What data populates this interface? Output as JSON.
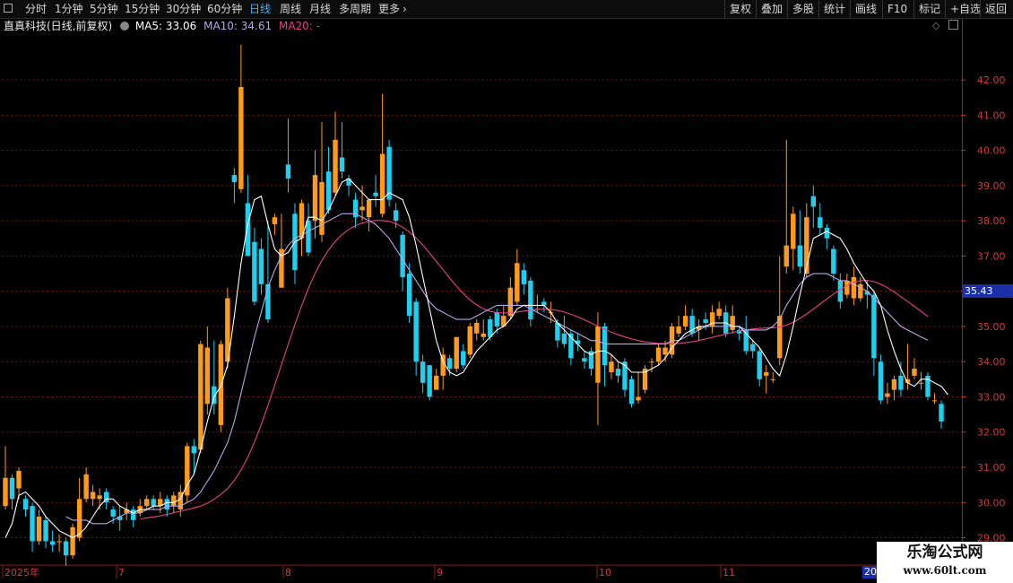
{
  "toolbar": {
    "periods": [
      {
        "label": "分时",
        "active": false
      },
      {
        "label": "1分钟",
        "active": false
      },
      {
        "label": "5分钟",
        "active": false
      },
      {
        "label": "15分钟",
        "active": false
      },
      {
        "label": "30分钟",
        "active": false
      },
      {
        "label": "60分钟",
        "active": false
      },
      {
        "label": "日线",
        "active": true
      },
      {
        "label": "周线",
        "active": false
      },
      {
        "label": "月线",
        "active": false
      },
      {
        "label": "多周期",
        "active": false
      },
      {
        "label": "更多",
        "active": false
      }
    ],
    "right_buttons": [
      "复权",
      "叠加",
      "多股",
      "统计",
      "画线",
      "F10",
      "标记",
      "+自选",
      "返回"
    ]
  },
  "info": {
    "stock": "直真科技(日线,前复权)",
    "ma5": "MA5: 33.06",
    "ma10": "MA10: 34.61",
    "ma20": "MA20: -"
  },
  "price_tag": "35.43",
  "date_end": "20",
  "watermark": {
    "title": "乐淘公式网",
    "url": "www.60lt.com"
  },
  "colors": {
    "up": "#ff9b1a",
    "down": "#1ed0ee",
    "ma5": "#ffffff",
    "ma10": "#b7a8e8",
    "ma20": "#e8408a",
    "grid": "#7a1515",
    "axis": "#d23c3c"
  },
  "chart_data": {
    "type": "candlestick",
    "y_range": [
      28.3,
      43.2
    ],
    "y_ticks": [
      "29.00",
      "30.00",
      "31.00",
      "32.00",
      "33.00",
      "34.00",
      "35.00",
      "36.00",
      "37.00",
      "38.00",
      "39.00",
      "40.00",
      "41.00",
      "42.00"
    ],
    "x_labels": [
      "2025年",
      "7",
      "8",
      "9",
      "10",
      "11",
      "20"
    ],
    "candles": [
      [
        29.9,
        30.7,
        31.6,
        29.8
      ],
      [
        30.7,
        30.1,
        30.8,
        29.8
      ],
      [
        30.4,
        30.9,
        31.0,
        30.1
      ],
      [
        30.1,
        29.8,
        30.2,
        29.6
      ],
      [
        29.9,
        28.9,
        30.0,
        28.6
      ],
      [
        28.9,
        29.6,
        29.8,
        28.8
      ],
      [
        29.5,
        28.9,
        29.6,
        28.7
      ],
      [
        28.9,
        28.8,
        29.2,
        28.6
      ],
      [
        28.9,
        28.9,
        29.1,
        28.6
      ],
      [
        28.9,
        28.5,
        29.0,
        28.2
      ],
      [
        28.5,
        29.3,
        29.4,
        28.4
      ],
      [
        29.0,
        30.1,
        30.7,
        28.9
      ],
      [
        30.1,
        30.8,
        31.0,
        30.0
      ],
      [
        30.1,
        30.3,
        30.5,
        29.9
      ],
      [
        30.1,
        30.2,
        30.4,
        29.8
      ],
      [
        30.3,
        30.0,
        30.4,
        29.8
      ],
      [
        29.8,
        29.6,
        29.9,
        29.4
      ],
      [
        29.6,
        29.5,
        29.9,
        29.2
      ],
      [
        29.7,
        29.8,
        30.0,
        29.5
      ],
      [
        29.8,
        29.5,
        29.9,
        29.3
      ],
      [
        29.7,
        29.9,
        30.1,
        29.6
      ],
      [
        29.9,
        30.1,
        30.2,
        29.8
      ],
      [
        30.1,
        29.9,
        30.2,
        29.8
      ],
      [
        29.9,
        30.1,
        30.3,
        29.7
      ],
      [
        30.1,
        29.8,
        30.2,
        29.6
      ],
      [
        29.9,
        30.2,
        30.3,
        29.7
      ],
      [
        29.8,
        30.3,
        30.5,
        29.6
      ],
      [
        30.2,
        31.6,
        31.7,
        30.0
      ],
      [
        31.6,
        31.4,
        31.8,
        30.8
      ],
      [
        31.5,
        34.5,
        34.6,
        31.4
      ],
      [
        32.8,
        34.4,
        35.0,
        32.5
      ],
      [
        33.3,
        32.8,
        34.6,
        32.5
      ],
      [
        32.2,
        34.5,
        34.6,
        32.0
      ],
      [
        34.0,
        35.8,
        36.1,
        33.8
      ],
      [
        39.3,
        39.1,
        39.5,
        38.5
      ],
      [
        38.9,
        41.8,
        43.0,
        38.8
      ],
      [
        38.5,
        37.0,
        39.3,
        37.0
      ],
      [
        37.4,
        35.7,
        37.8,
        35.6
      ],
      [
        37.2,
        36.2,
        37.5,
        35.9
      ],
      [
        36.2,
        35.2,
        38.0,
        35.1
      ],
      [
        37.9,
        38.1,
        38.2,
        37.6
      ],
      [
        36.1,
        37.2,
        38.2,
        36.1
      ],
      [
        39.6,
        39.2,
        40.9,
        38.8
      ],
      [
        38.2,
        36.6,
        38.5,
        36.2
      ],
      [
        37.5,
        38.5,
        38.6,
        37.0
      ],
      [
        38.0,
        37.1,
        38.5,
        37.0
      ],
      [
        38.0,
        39.3,
        40.0,
        37.5
      ],
      [
        37.6,
        39.1,
        40.8,
        37.4
      ],
      [
        39.4,
        38.3,
        40.1,
        38.2
      ],
      [
        38.8,
        40.3,
        41.1,
        38.7
      ],
      [
        39.8,
        39.4,
        40.8,
        39.2
      ],
      [
        39.2,
        39.0,
        39.3,
        38.7
      ],
      [
        38.6,
        38.1,
        38.8,
        37.8
      ],
      [
        38.3,
        38.4,
        39.0,
        38.0
      ],
      [
        38.1,
        38.6,
        38.6,
        37.7
      ],
      [
        38.8,
        38.7,
        39.3,
        38.4
      ],
      [
        38.2,
        39.9,
        41.6,
        38.1
      ],
      [
        40.1,
        38.6,
        40.3,
        38.4
      ],
      [
        38.3,
        38.0,
        38.5,
        37.8
      ],
      [
        37.6,
        36.4,
        37.7,
        36.0
      ],
      [
        36.5,
        35.3,
        36.8,
        35.1
      ],
      [
        35.7,
        34.0,
        35.8,
        33.6
      ],
      [
        34.0,
        33.4,
        34.2,
        33.1
      ],
      [
        33.9,
        33.0,
        33.9,
        32.9
      ],
      [
        33.2,
        33.6,
        33.8,
        33.2
      ],
      [
        33.6,
        34.2,
        34.4,
        33.2
      ],
      [
        34.1,
        33.8,
        34.2,
        33.6
      ],
      [
        33.8,
        34.7,
        34.7,
        33.7
      ],
      [
        34.3,
        33.9,
        34.5,
        33.8
      ],
      [
        34.2,
        35.0,
        35.1,
        34.1
      ],
      [
        34.8,
        35.1,
        35.2,
        34.6
      ],
      [
        34.7,
        34.8,
        35.2,
        34.6
      ],
      [
        35.2,
        34.7,
        35.3,
        34.6
      ],
      [
        35.4,
        35.0,
        35.5,
        34.8
      ],
      [
        35.0,
        35.3,
        35.6,
        35.0
      ],
      [
        35.3,
        36.1,
        36.4,
        35.2
      ],
      [
        35.7,
        36.8,
        37.2,
        35.6
      ],
      [
        36.6,
        36.2,
        36.8,
        35.9
      ],
      [
        36.3,
        35.2,
        36.4,
        35.0
      ],
      [
        35.5,
        35.5,
        35.9,
        35.4
      ],
      [
        35.7,
        35.6,
        35.8,
        35.4
      ],
      [
        35.4,
        35.4,
        35.7,
        35.1
      ],
      [
        35.1,
        34.6,
        35.2,
        34.4
      ],
      [
        34.8,
        34.5,
        35.3,
        34.4
      ],
      [
        34.8,
        34.1,
        34.9,
        33.9
      ],
      [
        34.6,
        34.5,
        34.8,
        34.3
      ],
      [
        34.1,
        34.0,
        34.3,
        33.8
      ],
      [
        34.3,
        33.8,
        34.4,
        33.6
      ],
      [
        33.4,
        35.0,
        35.4,
        32.2
      ],
      [
        35.0,
        33.9,
        35.1,
        33.3
      ],
      [
        33.7,
        34.0,
        34.2,
        33.5
      ],
      [
        33.8,
        33.6,
        34.0,
        33.4
      ],
      [
        34.0,
        33.2,
        34.1,
        33.0
      ],
      [
        33.5,
        32.8,
        33.6,
        32.7
      ],
      [
        32.9,
        33.0,
        33.7,
        32.8
      ],
      [
        33.2,
        33.8,
        33.9,
        33.1
      ],
      [
        34.0,
        34.0,
        34.1,
        33.7
      ],
      [
        34.0,
        34.4,
        34.5,
        33.9
      ],
      [
        34.2,
        34.4,
        34.6,
        34.0
      ],
      [
        34.2,
        35.0,
        35.1,
        34.1
      ],
      [
        34.8,
        35.0,
        35.3,
        34.7
      ],
      [
        35.0,
        35.3,
        35.6,
        34.9
      ],
      [
        35.3,
        34.8,
        35.5,
        34.7
      ],
      [
        34.9,
        35.0,
        35.2,
        34.6
      ],
      [
        35.2,
        35.1,
        35.4,
        34.9
      ],
      [
        35.0,
        35.4,
        35.6,
        34.8
      ],
      [
        35.3,
        35.5,
        35.7,
        35.2
      ],
      [
        35.4,
        34.8,
        35.6,
        34.7
      ],
      [
        34.9,
        35.3,
        35.6,
        34.8
      ],
      [
        34.9,
        34.8,
        35.0,
        34.6
      ],
      [
        34.9,
        34.3,
        35.3,
        34.2
      ],
      [
        34.5,
        34.3,
        34.6,
        34.1
      ],
      [
        34.3,
        33.5,
        34.4,
        33.3
      ],
      [
        33.6,
        33.7,
        33.9,
        33.1
      ],
      [
        33.5,
        33.5,
        33.7,
        33.4
      ],
      [
        34.1,
        35.3,
        37.0,
        33.9
      ],
      [
        36.7,
        37.3,
        40.3,
        36.5
      ],
      [
        37.2,
        38.2,
        38.4,
        36.6
      ],
      [
        37.3,
        36.7,
        38.3,
        36.5
      ],
      [
        36.5,
        38.1,
        38.5,
        36.4
      ],
      [
        38.7,
        38.4,
        39.0,
        37.8
      ],
      [
        38.1,
        37.8,
        38.5,
        37.6
      ],
      [
        37.8,
        37.5,
        37.9,
        37.2
      ],
      [
        37.2,
        36.5,
        37.3,
        36.3
      ],
      [
        36.3,
        35.7,
        36.5,
        35.5
      ],
      [
        35.9,
        36.3,
        36.5,
        35.8
      ],
      [
        35.8,
        36.4,
        36.7,
        35.6
      ],
      [
        35.8,
        36.2,
        36.4,
        35.7
      ],
      [
        36.0,
        35.9,
        36.3,
        35.5
      ],
      [
        35.9,
        34.1,
        36.0,
        33.6
      ],
      [
        34.0,
        32.9,
        34.2,
        32.8
      ],
      [
        33.0,
        33.1,
        33.4,
        32.8
      ],
      [
        33.2,
        33.5,
        33.6,
        32.9
      ],
      [
        33.6,
        33.2,
        34.0,
        33.0
      ],
      [
        33.4,
        33.5,
        34.5,
        33.2
      ],
      [
        33.6,
        33.8,
        34.1,
        33.5
      ],
      [
        33.4,
        33.4,
        33.7,
        33.2
      ],
      [
        33.6,
        33.0,
        33.7,
        32.9
      ],
      [
        32.9,
        32.9,
        33.1,
        32.8
      ],
      [
        32.8,
        32.3,
        32.9,
        32.1
      ]
    ],
    "ma5": [
      29.0,
      29.4,
      30.2,
      30.3,
      30.1,
      29.9,
      29.6,
      29.4,
      29.2,
      29.1,
      29.0,
      29.1,
      29.3,
      29.6,
      29.9,
      30.1,
      30.1,
      29.9,
      29.8,
      29.7,
      29.8,
      29.8,
      29.9,
      29.9,
      30.0,
      30.0,
      30.1,
      30.5,
      30.8,
      31.5,
      32.3,
      33.0,
      33.3,
      33.9,
      35.3,
      36.8,
      37.9,
      38.6,
      38.7,
      37.9,
      37.2,
      37.0,
      37.1,
      37.4,
      37.5,
      38.1,
      38.1,
      38.0,
      38.3,
      38.7,
      39.1,
      39.2,
      39.0,
      38.8,
      38.6,
      38.6,
      38.6,
      38.8,
      38.7,
      38.6,
      38.1,
      37.3,
      36.4,
      35.5,
      34.6,
      34.0,
      33.7,
      33.6,
      33.7,
      34.0,
      34.3,
      34.5,
      34.7,
      34.9,
      35.0,
      35.2,
      35.5,
      35.6,
      35.6,
      35.6,
      35.6,
      35.4,
      35.1,
      34.9,
      34.7,
      34.5,
      34.3,
      34.2,
      34.3,
      34.3,
      34.2,
      34.0,
      33.9,
      33.7,
      33.7,
      33.7,
      33.8,
      33.9,
      34.1,
      34.4,
      34.6,
      34.8,
      34.9,
      35.0,
      35.0,
      35.1,
      35.1,
      35.1,
      35.0,
      35.0,
      34.8,
      34.6,
      34.4,
      34.1,
      33.8,
      33.6,
      34.2,
      35.0,
      35.9,
      36.7,
      37.5,
      37.6,
      37.7,
      37.6,
      37.5,
      37.2,
      36.8,
      36.5,
      36.2,
      36.0,
      35.6,
      34.9,
      34.3,
      33.8,
      33.4,
      33.3,
      33.5,
      33.5,
      33.4,
      33.3,
      33.06
    ],
    "ma10": [
      null,
      null,
      null,
      null,
      null,
      null,
      null,
      null,
      null,
      29.6,
      29.5,
      29.5,
      29.5,
      29.4,
      29.4,
      29.4,
      29.5,
      29.6,
      29.7,
      29.7,
      29.7,
      29.8,
      29.8,
      29.8,
      29.9,
      29.9,
      29.9,
      30.0,
      30.1,
      30.3,
      30.6,
      30.9,
      31.3,
      31.7,
      32.3,
      33.1,
      33.9,
      34.7,
      35.4,
      36.1,
      36.6,
      37.0,
      37.3,
      37.5,
      37.6,
      37.7,
      37.8,
      37.9,
      38.0,
      38.1,
      38.2,
      38.2,
      38.2,
      38.1,
      38.0,
      37.9,
      37.7,
      37.5,
      37.2,
      36.9,
      36.6,
      36.3,
      36.0,
      35.7,
      35.5,
      35.4,
      35.3,
      35.2,
      35.2,
      35.2,
      35.3,
      35.4,
      35.5,
      35.6,
      35.6,
      35.6,
      35.6,
      35.6,
      35.5,
      35.4,
      35.3,
      35.2,
      35.1,
      35.0,
      34.9,
      34.8,
      34.7,
      34.6,
      34.6,
      34.5,
      34.5,
      34.5,
      34.5,
      34.5,
      34.5,
      34.5,
      34.5,
      34.5,
      34.5,
      34.6,
      34.6,
      34.7,
      34.8,
      34.9,
      35.0,
      35.0,
      35.0,
      35.0,
      35.0,
      35.0,
      34.9,
      34.9,
      34.9,
      34.9,
      35.0,
      35.2,
      35.6,
      35.9,
      36.2,
      36.4,
      36.5,
      36.5,
      36.5,
      36.4,
      36.3,
      36.3,
      36.2,
      36.1,
      36.0,
      35.8,
      35.6,
      35.4,
      35.2,
      35.0,
      34.9,
      34.8,
      34.7,
      34.61
    ],
    "ma20_start": 20
  }
}
